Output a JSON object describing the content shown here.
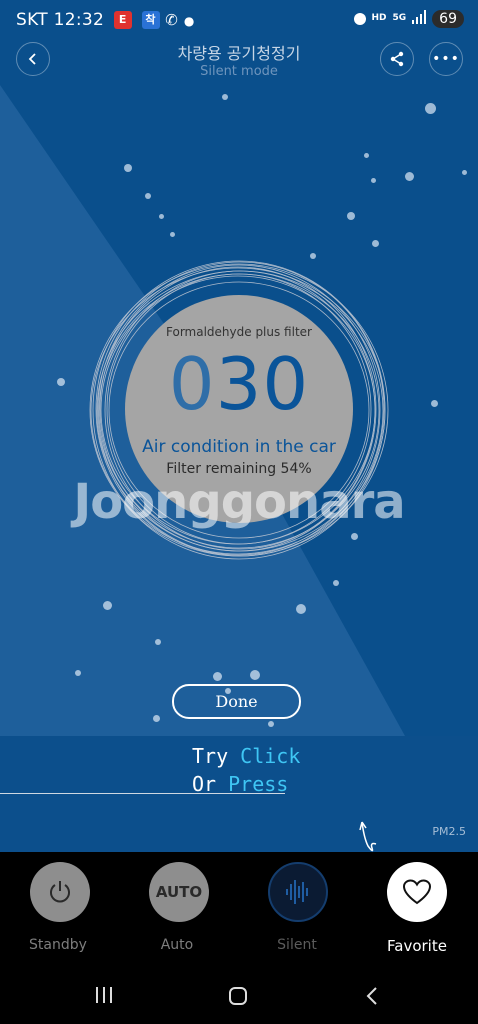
{
  "status_bar": {
    "carrier": "SKT",
    "time": "12:32",
    "app_badges": [
      "E",
      "착"
    ],
    "battery": "69"
  },
  "header": {
    "title": "차량용 공기청정기",
    "subtitle": "Silent mode"
  },
  "gauge": {
    "filter_name": "Formaldehyde plus filter",
    "value_lead": "0",
    "value_rest": "30",
    "air_condition": "Air condition in the car",
    "filter_remaining": "Filter remaining 54%"
  },
  "watermark": "Joonggonara",
  "done_button": "Done",
  "hint": {
    "try": "Try",
    "click": "Click",
    "or": "Or",
    "press": "Press"
  },
  "pm_label": "PM2.5",
  "modes": [
    {
      "label": "Standby",
      "icon": "power-icon"
    },
    {
      "label": "Auto",
      "icon_text": "AUTO"
    },
    {
      "label": "Silent",
      "icon": "silent-wave-icon"
    },
    {
      "label": "Favorite",
      "icon": "heart-icon"
    }
  ],
  "colors": {
    "background": "#0a4f8c",
    "accent": "#0a5499",
    "highlight": "#3fc6f4"
  }
}
